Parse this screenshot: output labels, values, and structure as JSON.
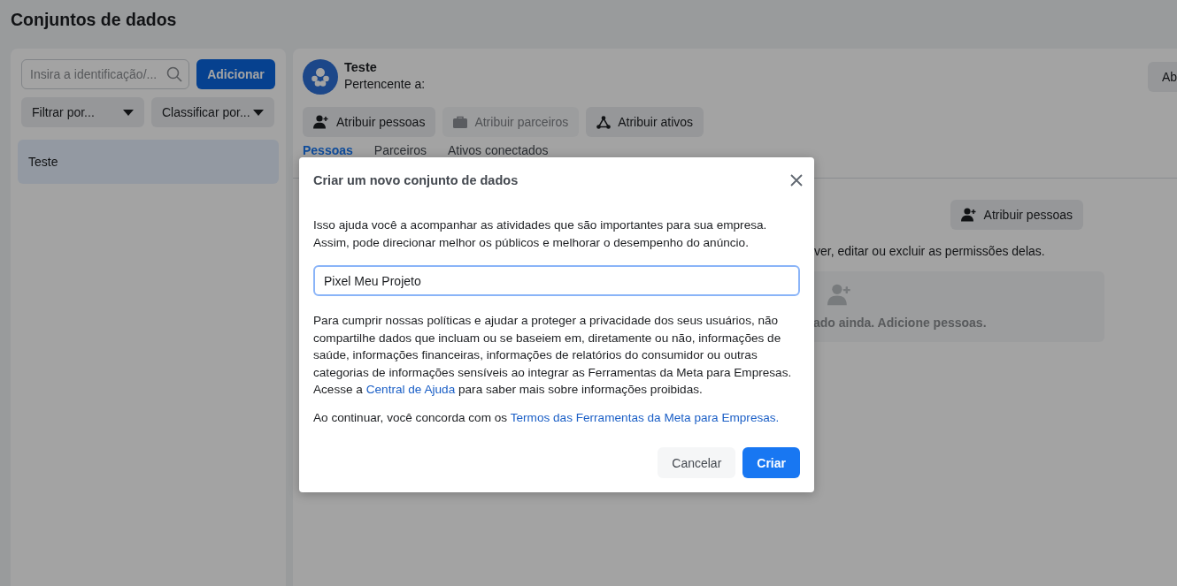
{
  "page": {
    "title": "Conjuntos de dados"
  },
  "sidebar": {
    "search": {
      "placeholder": "Insira a identificação/..."
    },
    "add_button": "Adicionar",
    "filters": [
      {
        "label": "Filtrar por..."
      },
      {
        "label": "Classificar por..."
      }
    ],
    "items": [
      {
        "label": "Teste",
        "selected": true
      }
    ]
  },
  "dataset": {
    "name": "Teste",
    "owner_label": "Pertencente a:",
    "top_right_button": "Ab",
    "actions": [
      {
        "label": "Atribuir pessoas",
        "disabled": false
      },
      {
        "label": "Atribuir parceiros",
        "disabled": true
      },
      {
        "label": "Atribuir ativos",
        "disabled": false
      }
    ],
    "tabs": [
      {
        "label": "Pessoas",
        "selected": true
      },
      {
        "label": "Parceiros",
        "selected": false
      },
      {
        "label": "Ativos conectados",
        "selected": false
      }
    ],
    "people": {
      "assign_button": "Atribuir pessoas",
      "description": "ver, editar ou excluir as permissões delas.",
      "empty_message": "ado ainda. Adicione pessoas."
    }
  },
  "dialog": {
    "title": "Criar um novo conjunto de dados",
    "intro": "Isso ajuda você a acompanhar as atividades que são importantes para sua empresa. Assim, pode direcionar melhor os públicos e melhorar o desempenho do anúncio.",
    "name_field": {
      "value": "Pixel Meu Projeto",
      "focused": true
    },
    "policy": {
      "before": "Para cumprir nossas políticas e ajudar a proteger a privacidade dos seus usuários, não compartilhe dados que incluam ou se baseiem em, diretamente ou não, informações de saúde, informações financeiras, informações de relatórios do consumidor ou outras categorias de informações sensíveis ao integrar as Ferramentas da Meta para Empresas. Acesse a ",
      "link": "Central de Ajuda",
      "after": " para saber mais sobre informações proibidas."
    },
    "agreement": {
      "before": "Ao continuar, você concorda com os ",
      "link": "Termos das Ferramentas da Meta para Empresas."
    },
    "buttons": [
      {
        "label": "Cancelar",
        "kind": "secondary"
      },
      {
        "label": "Criar",
        "kind": "primary"
      }
    ]
  }
}
